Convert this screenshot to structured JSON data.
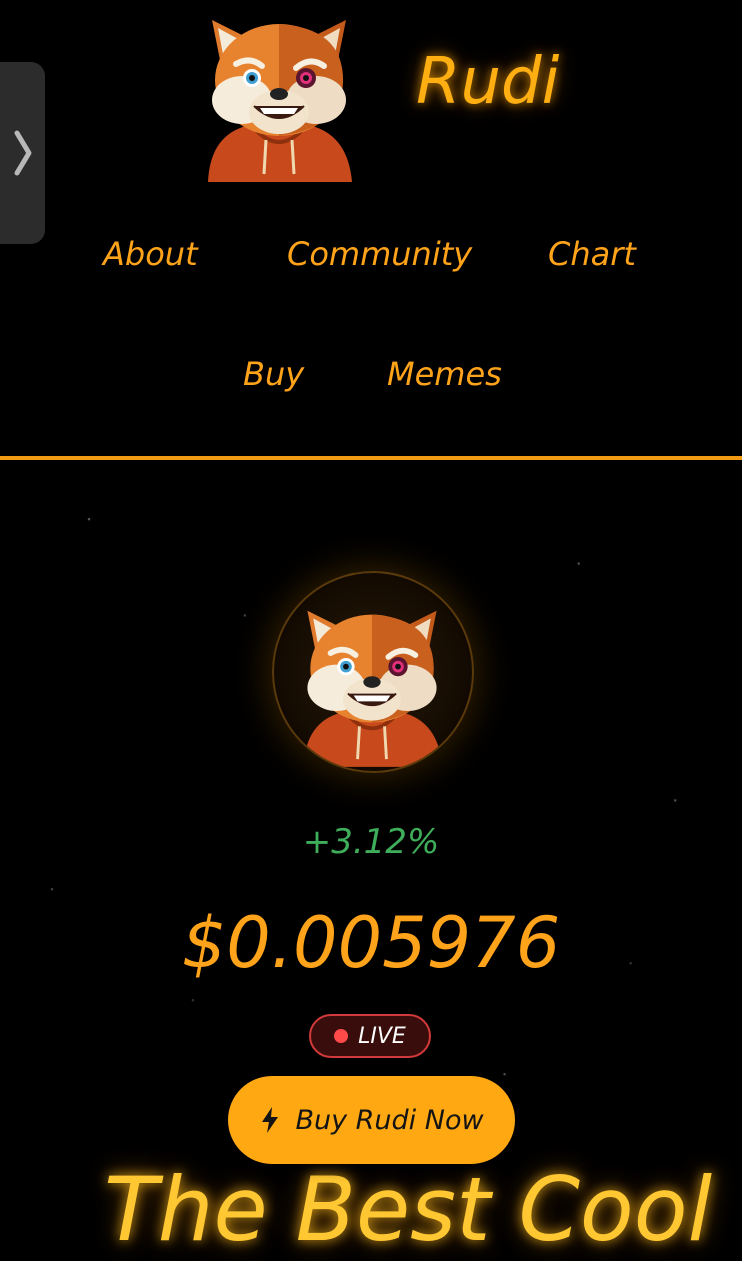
{
  "header": {
    "brand": "Rudi",
    "logo_icon": "red-panda-mascot-icon"
  },
  "nav": {
    "items": [
      {
        "label": "About"
      },
      {
        "label": "Community"
      },
      {
        "label": "Chart"
      },
      {
        "label": "Buy"
      },
      {
        "label": "Memes"
      }
    ]
  },
  "drawer": {
    "icon": "chevron-right-icon"
  },
  "hero": {
    "avatar_icon": "red-panda-mascot-icon",
    "change": "+3.12%",
    "price": "$0.005976",
    "live_label": "LIVE",
    "buy_button_label": "Buy Rudi Now",
    "buy_button_icon": "lightning-icon",
    "headline_partial": "The Best Cool"
  },
  "colors": {
    "accent": "#ffa31a",
    "background": "#000000",
    "positive": "#3fae5a",
    "live": "#ff4a4a"
  }
}
